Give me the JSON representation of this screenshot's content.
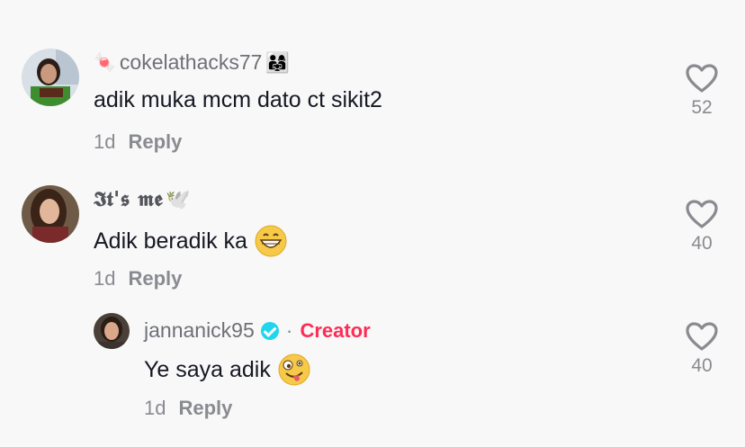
{
  "comments": [
    {
      "username": "cokelathacks77",
      "username_prefix_icon": "candy-icon",
      "username_suffix_icon": "family-icon",
      "text": "adik muka mcm dato ct sikit2",
      "time": "1d",
      "reply_label": "Reply",
      "likes": "52"
    },
    {
      "username": "𝕴𝖙'𝖘 𝖒𝖊",
      "username_suffix_icon": "dove-icon",
      "text": "Adik beradik ka",
      "text_emoji": "grinning-face-emoji",
      "time": "1d",
      "reply_label": "Reply",
      "likes": "40"
    },
    {
      "username": "jannanick95",
      "verified": true,
      "separator": "·",
      "creator_label": "Creator",
      "text": "Ye saya adik",
      "text_emoji": "zany-face-emoji",
      "time": "1d",
      "reply_label": "Reply",
      "likes": "40"
    }
  ],
  "colors": {
    "background": "#f8f8f8",
    "creator": "#fe2c55",
    "verified": "#20d5ec",
    "secondary_text": "#8a8b91"
  }
}
